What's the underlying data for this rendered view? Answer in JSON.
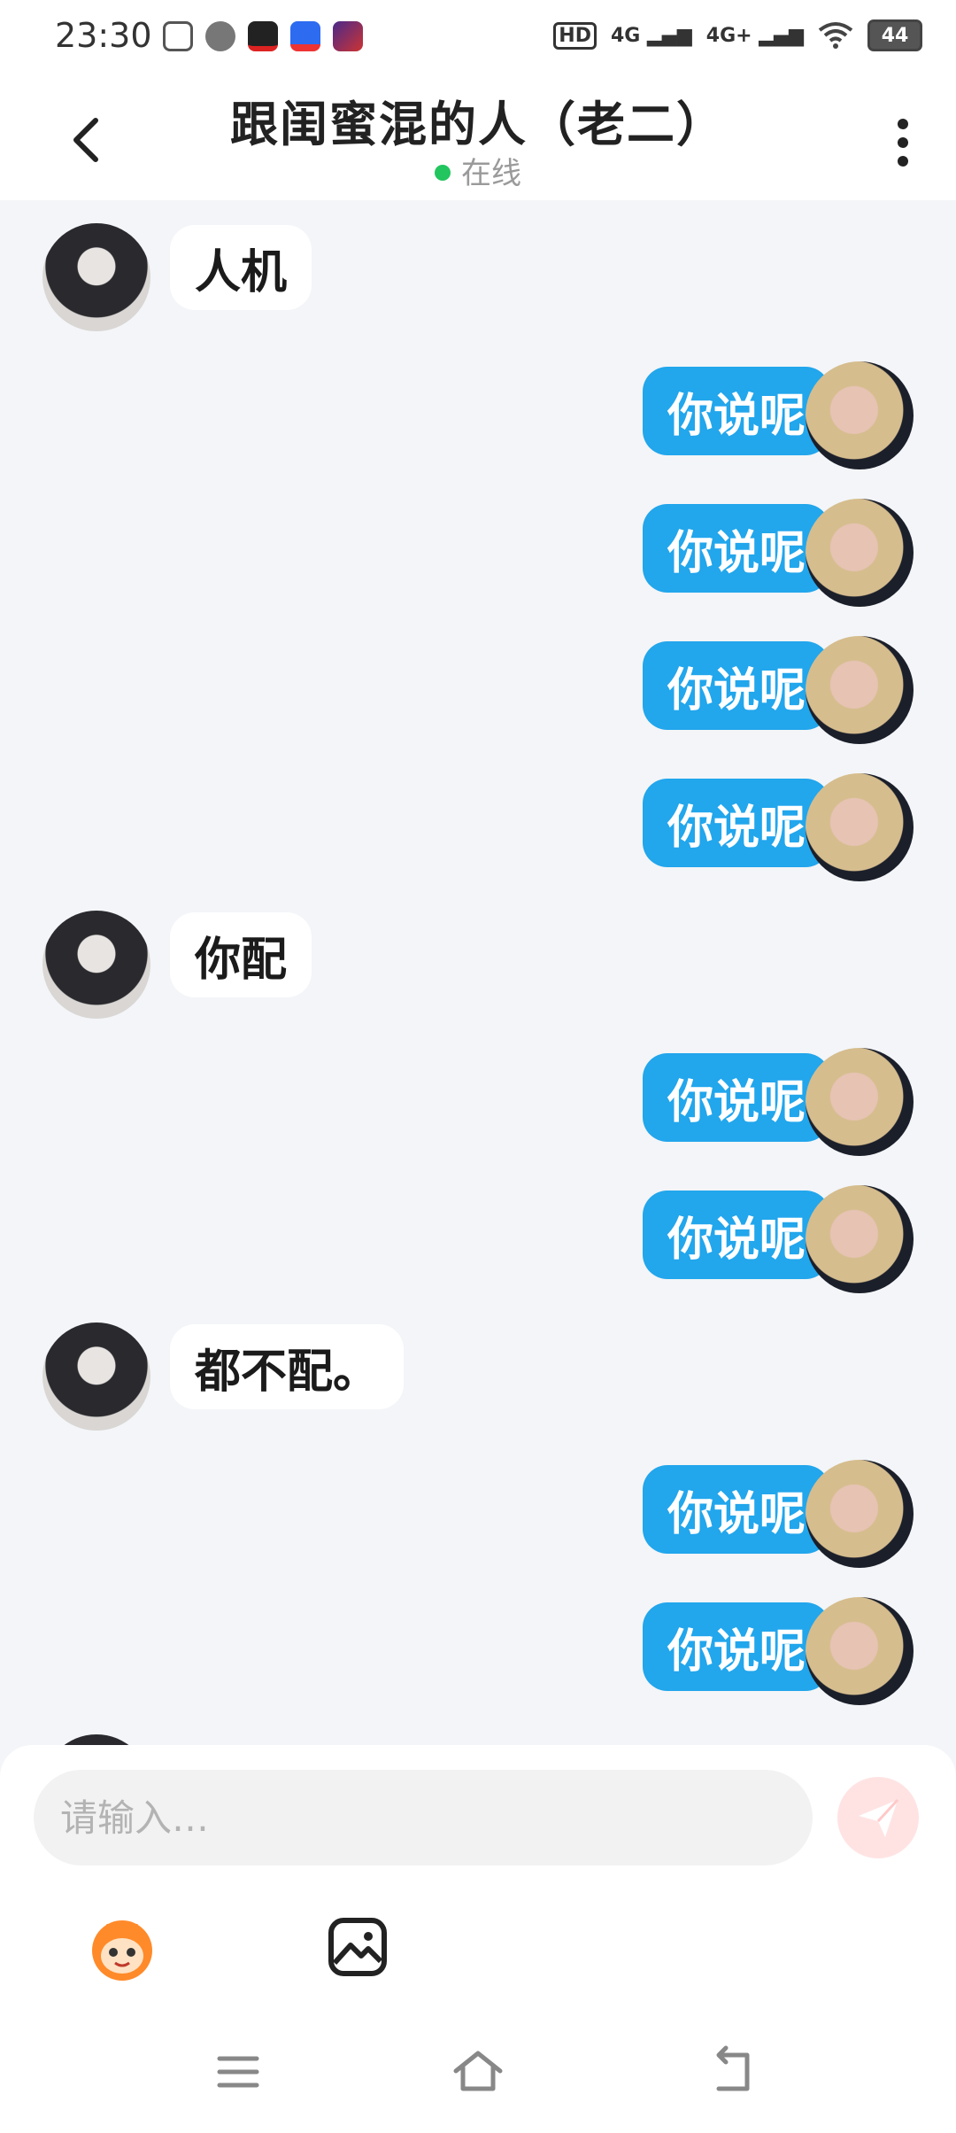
{
  "status_bar": {
    "time": "23:30",
    "network": [
      "HD",
      "4G",
      "4G+"
    ],
    "battery": "44"
  },
  "header": {
    "title": "跟闺蜜混的人（老二）",
    "status": "在线",
    "status_color": "#22c55e"
  },
  "messages": [
    {
      "side": "in",
      "text": "人机"
    },
    {
      "side": "out",
      "text": "你说呢"
    },
    {
      "side": "out",
      "text": "你说呢"
    },
    {
      "side": "out",
      "text": "你说呢"
    },
    {
      "side": "out",
      "text": "你说呢"
    },
    {
      "side": "in",
      "text": "你配"
    },
    {
      "side": "out",
      "text": "你说呢"
    },
    {
      "side": "out",
      "text": "你说呢"
    },
    {
      "side": "in",
      "text": "都不配。"
    },
    {
      "side": "out",
      "text": "你说呢"
    },
    {
      "side": "out",
      "text": "你说呢"
    }
  ],
  "composer": {
    "placeholder": "请输入…",
    "send_color": "#ff6b6b"
  },
  "colors": {
    "outgoing_bubble": "#22a6ec",
    "incoming_bubble": "#ffffff",
    "background": "#f3f5f8"
  }
}
